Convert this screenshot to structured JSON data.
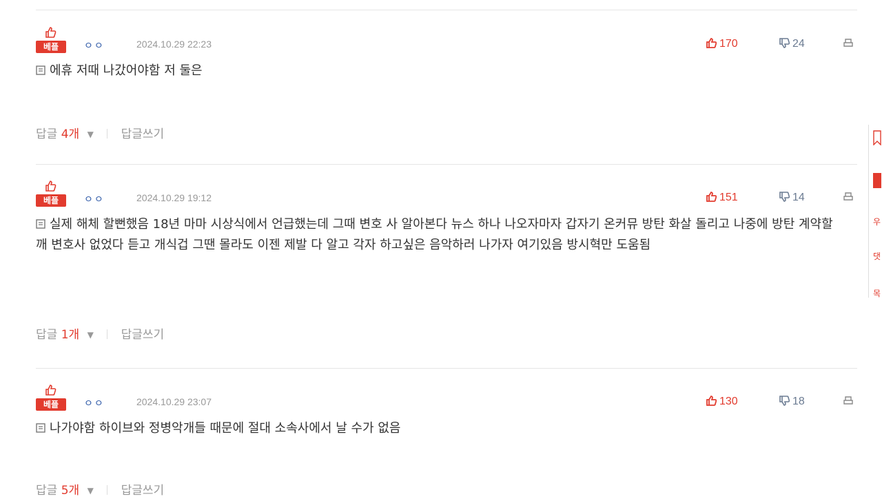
{
  "comments": [
    {
      "badge": "베플",
      "author": "ㅇㅇ",
      "date": "2024.10.29 22:23",
      "likes": "170",
      "dislikes": "24",
      "text": "에휴 저때 나갔어야함 저 둘은",
      "reply_label": "답글",
      "reply_count": "4개",
      "write_reply": "답글쓰기"
    },
    {
      "badge": "베플",
      "author": "ㅇㅇ",
      "date": "2024.10.29 19:12",
      "likes": "151",
      "dislikes": "14",
      "text": "실제 해체 할뻔했음 18년 마마 시상식에서 언급했는데 그때 변호 사 알아본다 뉴스 하나 나오자마자 갑자기 온커뮤 방탄 화살 돌리고 나중에 방탄 계약할깨 변호사 없었다 듣고 개식겁 그땐 몰라도 이젠 제발 다 알고 각자 하고싶은 음악하러 나가자 여기있음 방시혁만 도움됨",
      "reply_label": "답글",
      "reply_count": "1개",
      "write_reply": "답글쓰기"
    },
    {
      "badge": "베플",
      "author": "ㅇㅇ",
      "date": "2024.10.29 23:07",
      "likes": "130",
      "dislikes": "18",
      "text": "나가야함 하이브와 정병악개들 때문에 절대 소속사에서 날 수가 없음",
      "reply_label": "답글",
      "reply_count": "5개",
      "write_reply": "답글쓰기"
    }
  ],
  "side": {
    "items": [
      "우",
      "댓",
      "목"
    ]
  },
  "colors": {
    "accent": "#e23b2e",
    "author": "#2f5aa8",
    "muted": "#999999",
    "divider": "#e6e6e6"
  }
}
